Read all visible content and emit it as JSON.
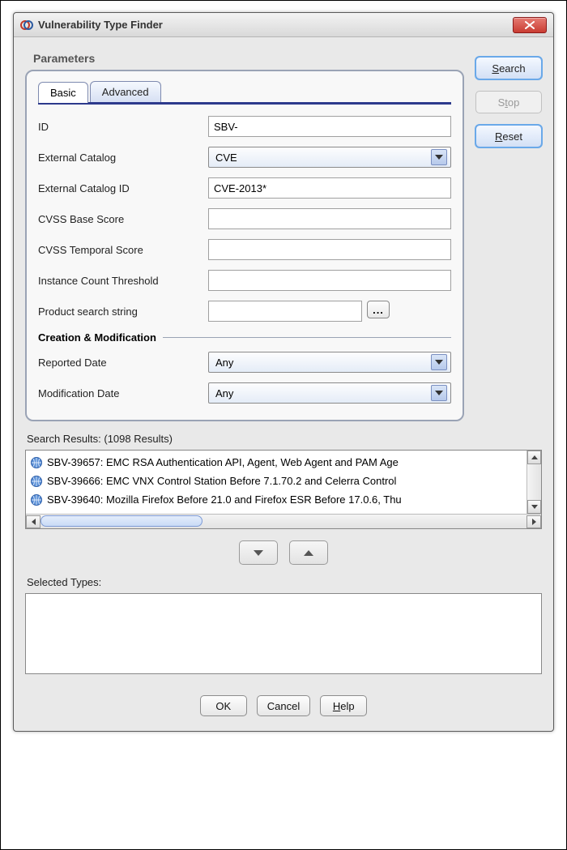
{
  "window": {
    "title": "Vulnerability Type Finder"
  },
  "sidebar_buttons": {
    "search": "Search",
    "stop": "Stop",
    "reset": "Reset"
  },
  "parameters": {
    "heading": "Parameters",
    "tabs": {
      "basic": "Basic",
      "advanced": "Advanced"
    },
    "fields": {
      "id_label": "ID",
      "id_value": "SBV-",
      "external_catalog_label": "External Catalog",
      "external_catalog_value": "CVE",
      "external_catalog_id_label": "External Catalog ID",
      "external_catalog_id_value": "CVE-2013*",
      "cvss_base_label": "CVSS Base Score",
      "cvss_base_value": "",
      "cvss_temporal_label": "CVSS Temporal Score",
      "cvss_temporal_value": "",
      "instance_count_label": "Instance Count Threshold",
      "instance_count_value": "",
      "product_search_label": "Product search string",
      "product_search_value": "",
      "ellipsis": "..."
    },
    "subsection": "Creation & Modification",
    "dates": {
      "reported_label": "Reported Date",
      "reported_value": "Any",
      "modification_label": "Modification Date",
      "modification_value": "Any"
    }
  },
  "results": {
    "label": "Search Results:   (1098 Results)",
    "items": [
      "SBV-39657: EMC RSA Authentication API, Agent, Web Agent and PAM Age",
      "SBV-39666: EMC VNX Control Station Before 7.1.70.2 and Celerra Control",
      "SBV-39640: Mozilla Firefox Before 21.0 and Firefox ESR Before 17.0.6, Thu"
    ]
  },
  "selected": {
    "label": "Selected Types:"
  },
  "bottom": {
    "ok": "OK",
    "cancel": "Cancel",
    "help": "Help"
  }
}
